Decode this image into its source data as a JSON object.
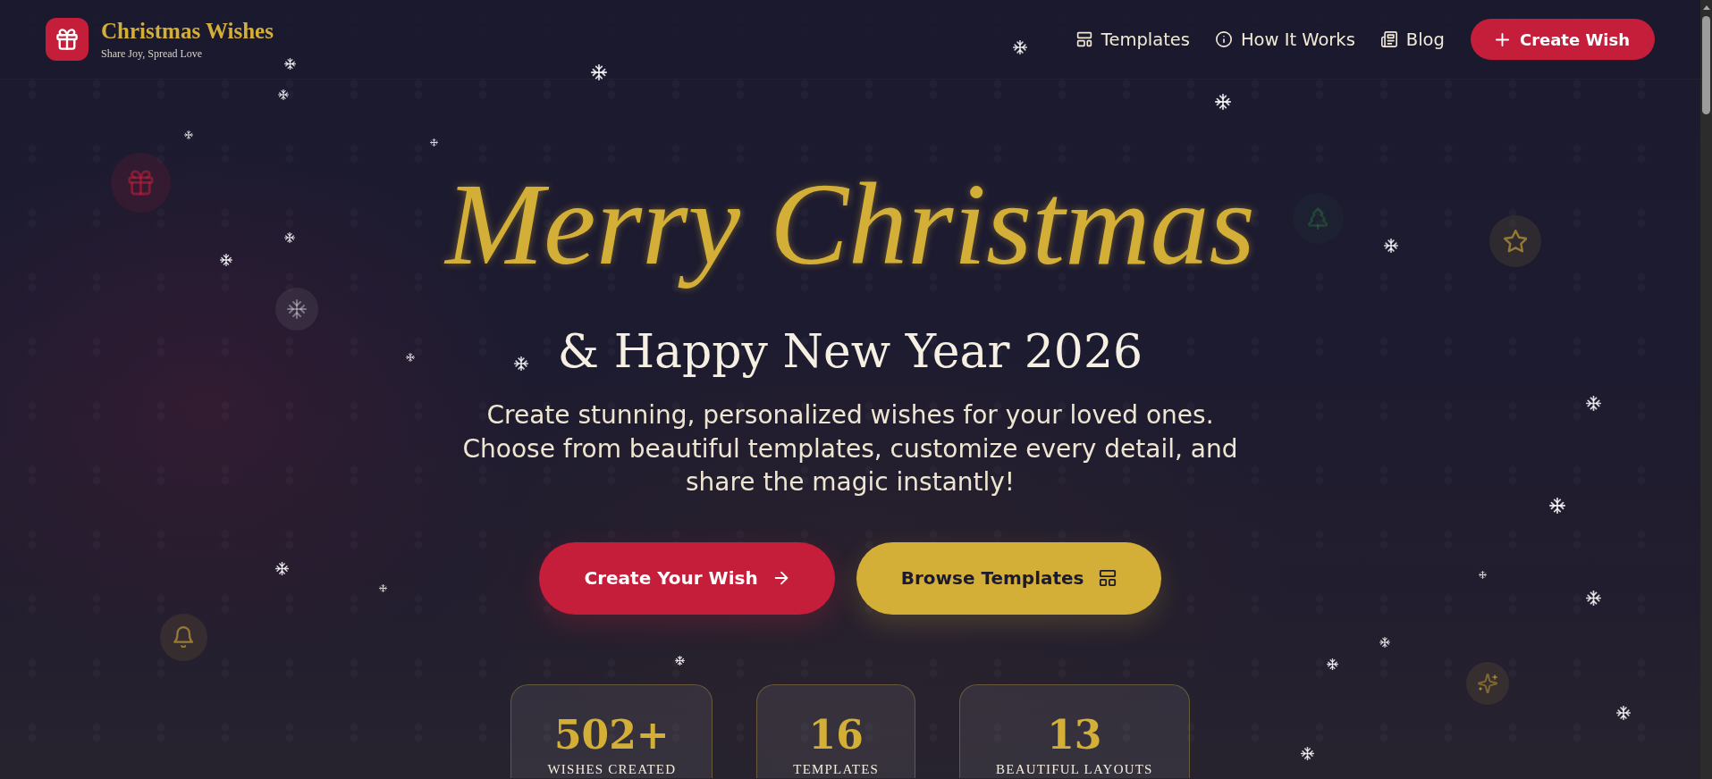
{
  "brand": {
    "title": "Christmas Wishes",
    "tagline": "Share Joy, Spread Love"
  },
  "nav": {
    "links": [
      {
        "label": "Templates"
      },
      {
        "label": "How It Works"
      },
      {
        "label": "Blog"
      }
    ],
    "cta": {
      "label": "Create Wish"
    }
  },
  "hero": {
    "title": "Merry Christmas",
    "subtitle": "& Happy New Year 2026",
    "description": "Create stunning, personalized wishes for your loved ones. Choose from beautiful templates, customize every detail, and share the magic instantly!",
    "buttons": [
      {
        "label": "Create Your Wish",
        "kind": "primary"
      },
      {
        "label": "Browse Templates",
        "kind": "secondary"
      }
    ]
  },
  "stats": [
    {
      "value": "502+",
      "label": "WISHES CREATED"
    },
    {
      "value": "16",
      "label": "TEMPLATES"
    },
    {
      "value": "13",
      "label": "BEAUTIFUL LAYOUTS"
    }
  ]
}
